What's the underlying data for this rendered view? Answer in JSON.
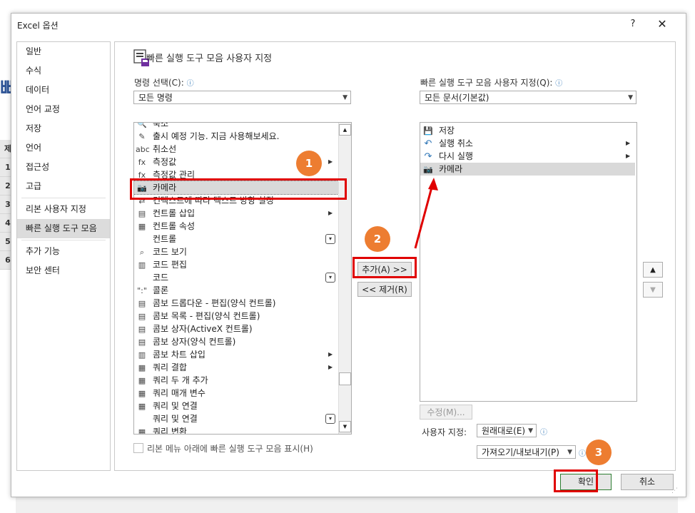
{
  "dialog": {
    "title": "Excel 옵션",
    "help_label": "?",
    "close_label": "✕",
    "section_title": "빠른 실행 도구 모음 사용자 지정"
  },
  "excel_bg": {
    "title_fragment": "빠",
    "row_numbers": [
      "제",
      "1",
      "2",
      "3",
      "4",
      "5",
      "6"
    ]
  },
  "sidebar": {
    "items": [
      {
        "label": "일반"
      },
      {
        "label": "수식"
      },
      {
        "label": "데이터"
      },
      {
        "label": "언어 교정"
      },
      {
        "label": "저장"
      },
      {
        "label": "언어"
      },
      {
        "label": "접근성"
      },
      {
        "label": "고급"
      },
      {
        "label": "리본 사용자 지정"
      },
      {
        "label": "빠른 실행 도구 모음"
      },
      {
        "label": "추가 기능"
      },
      {
        "label": "보안 센터"
      }
    ],
    "selected": "빠른 실행 도구 모음"
  },
  "left": {
    "label": "명령 선택(C):",
    "combo_value": "모든 명령",
    "commands": [
      {
        "label": "축소",
        "icon": "zoom-out-icon",
        "glyph": "🔍"
      },
      {
        "label": "출시 예정 기능. 지금 사용해보세요.",
        "icon": "wand-icon",
        "glyph": "✎"
      },
      {
        "label": "취소선",
        "icon": "strikethrough-icon",
        "glyph": "abc"
      },
      {
        "label": "측정값",
        "icon": "fx-icon",
        "glyph": "fx",
        "submenu": true
      },
      {
        "label": "측정값 관리",
        "icon": "fx-manage-icon",
        "glyph": "fx"
      },
      {
        "label": "카메라",
        "icon": "camera-icon",
        "glyph": "📷",
        "selected": true
      },
      {
        "label": "컨텍스트에 따라 텍스트 방향 설정",
        "icon": "text-direction-icon",
        "glyph": "⇄"
      },
      {
        "label": "컨트롤 삽입",
        "icon": "toolbox-icon",
        "glyph": "▤",
        "submenu": true
      },
      {
        "label": "컨트롤 속성",
        "icon": "properties-icon",
        "glyph": "▦"
      },
      {
        "label": "컨트롤",
        "icon": "blank-icon",
        "glyph": "",
        "dropdown": true
      },
      {
        "label": "코드 보기",
        "icon": "view-code-icon",
        "glyph": "⌕"
      },
      {
        "label": "코드 편집",
        "icon": "edit-code-icon",
        "glyph": "▥"
      },
      {
        "label": "코드",
        "icon": "blank-icon",
        "glyph": "",
        "dropdown": true
      },
      {
        "label": "콜론",
        "icon": "colon-icon",
        "glyph": "\":\""
      },
      {
        "label": "콤보 드롭다운 - 편집(양식 컨트롤)",
        "icon": "combo-icon",
        "glyph": "▤"
      },
      {
        "label": "콤보 목록 - 편집(양식 컨트롤)",
        "icon": "combo-list-icon",
        "glyph": "▤"
      },
      {
        "label": "콤보 상자(ActiveX 컨트롤)",
        "icon": "combo-box-icon",
        "glyph": "▤"
      },
      {
        "label": "콤보 상자(양식 컨트롤)",
        "icon": "combo-box-form-icon",
        "glyph": "▤"
      },
      {
        "label": "콤보 차트 삽입",
        "icon": "chart-icon",
        "glyph": "▥",
        "submenu": true
      },
      {
        "label": "쿼리 결합",
        "icon": "query-merge-icon",
        "glyph": "▦",
        "submenu": true
      },
      {
        "label": "쿼리 두 개 추가",
        "icon": "query-append-icon",
        "glyph": "▦"
      },
      {
        "label": "쿼리 매개 변수",
        "icon": "query-param-icon",
        "glyph": "▦"
      },
      {
        "label": "쿼리 및 연결",
        "icon": "query-connect-icon",
        "glyph": "▦"
      },
      {
        "label": "쿼리 및 연결",
        "icon": "blank-icon",
        "glyph": "",
        "dropdown": true
      },
      {
        "label": "쿼리 변환",
        "icon": "query-transform-icon",
        "glyph": "▦"
      }
    ],
    "checkbox_label": "리본 메뉴 아래에 빠른 실행 도구 모음 표시(H)"
  },
  "middle": {
    "add_label": "추가(A) >>",
    "remove_label": "<< 제거(R)"
  },
  "right": {
    "label": "빠른 실행 도구 모음 사용자 지정(Q):",
    "combo_value": "모든 문서(기본값)",
    "items": [
      {
        "label": "저장",
        "icon": "save-icon",
        "glyph": "💾"
      },
      {
        "label": "실행 취소",
        "icon": "undo-icon",
        "glyph": "↶",
        "submenu": true
      },
      {
        "label": "다시 실행",
        "icon": "redo-icon",
        "glyph": "↷",
        "submenu": true
      },
      {
        "label": "카메라",
        "icon": "camera-icon",
        "glyph": "📷",
        "selected": true
      }
    ],
    "modify_label": "수정(M)...",
    "custom_label": "사용자 지정:",
    "reset_label": "원래대로(E)",
    "import_label": "가져오기/내보내기(P)"
  },
  "footer": {
    "ok_label": "확인",
    "cancel_label": "취소"
  },
  "callouts": [
    "1",
    "2",
    "3"
  ],
  "colors": {
    "callout": "#ed7d31",
    "highlight": "#e00000",
    "selected_row": "#d9d9d9"
  }
}
